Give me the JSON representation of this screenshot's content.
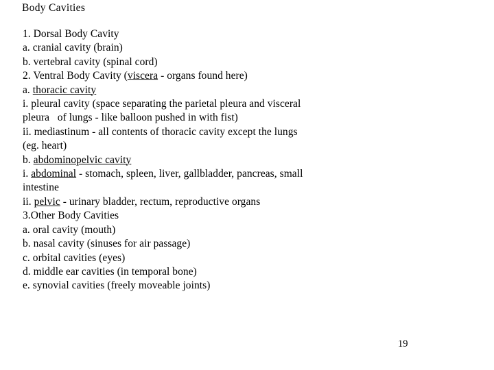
{
  "slide": {
    "title": "Body Cavities",
    "page_number": "19",
    "text_color": "#000000",
    "background_color": "#ffffff",
    "lines": [
      {
        "id": "line-1",
        "segments": [
          {
            "text": "1. Dorsal Body Cavity",
            "underline": false
          }
        ]
      },
      {
        "id": "line-2",
        "segments": [
          {
            "text": "a. cranial cavity (brain)",
            "underline": false
          }
        ]
      },
      {
        "id": "line-3",
        "segments": [
          {
            "text": "b. vertebral cavity (spinal cord)",
            "underline": false
          }
        ]
      },
      {
        "id": "line-4",
        "segments": [
          {
            "text": "2. Ventral Body Cavity (",
            "underline": false
          },
          {
            "text": "viscera",
            "underline": true
          },
          {
            "text": " - organs found here)",
            "underline": false
          }
        ]
      },
      {
        "id": "line-5",
        "segments": [
          {
            "text": "a. ",
            "underline": false
          },
          {
            "text": "thoracic cavity",
            "underline": true
          }
        ]
      },
      {
        "id": "line-6",
        "segments": [
          {
            "text": "i. pleural cavity (space separating the parietal pleura and visceral",
            "underline": false
          }
        ]
      },
      {
        "id": "line-7",
        "segments": [
          {
            "text": "pleura   of lungs - like balloon pushed in with fist)",
            "underline": false
          }
        ]
      },
      {
        "id": "line-8",
        "segments": [
          {
            "text": "ii. mediastinum - all contents of thoracic cavity except the lungs",
            "underline": false
          }
        ]
      },
      {
        "id": "line-9",
        "segments": [
          {
            "text": "(eg. heart)",
            "underline": false
          }
        ]
      },
      {
        "id": "line-10",
        "segments": [
          {
            "text": "b. ",
            "underline": false
          },
          {
            "text": "abdominopelvic cavity",
            "underline": true
          }
        ]
      },
      {
        "id": "line-11",
        "segments": [
          {
            "text": "i. ",
            "underline": false
          },
          {
            "text": "abdominal",
            "underline": true
          },
          {
            "text": " - stomach, spleen, liver, gallbladder, pancreas, small",
            "underline": false
          }
        ]
      },
      {
        "id": "line-12",
        "segments": [
          {
            "text": "intestine",
            "underline": false
          }
        ]
      },
      {
        "id": "line-13",
        "segments": [
          {
            "text": "ii. ",
            "underline": false
          },
          {
            "text": "pelvic",
            "underline": true
          },
          {
            "text": " - urinary bladder, rectum, reproductive organs",
            "underline": false
          }
        ]
      },
      {
        "id": "line-14",
        "segments": [
          {
            "text": "3.Other Body Cavities",
            "underline": false
          }
        ]
      },
      {
        "id": "line-15",
        "segments": [
          {
            "text": "a. oral cavity (mouth)",
            "underline": false
          }
        ]
      },
      {
        "id": "line-16",
        "segments": [
          {
            "text": "b. nasal cavity (sinuses for air passage)",
            "underline": false
          }
        ]
      },
      {
        "id": "line-17",
        "segments": [
          {
            "text": "c. orbital cavities (eyes)",
            "underline": false
          }
        ]
      },
      {
        "id": "line-18",
        "segments": [
          {
            "text": "d. middle ear cavities (in temporal bone)",
            "underline": false
          }
        ]
      },
      {
        "id": "line-19",
        "segments": [
          {
            "text": "e. synovial cavities (freely moveable joints)",
            "underline": false
          }
        ]
      }
    ]
  }
}
